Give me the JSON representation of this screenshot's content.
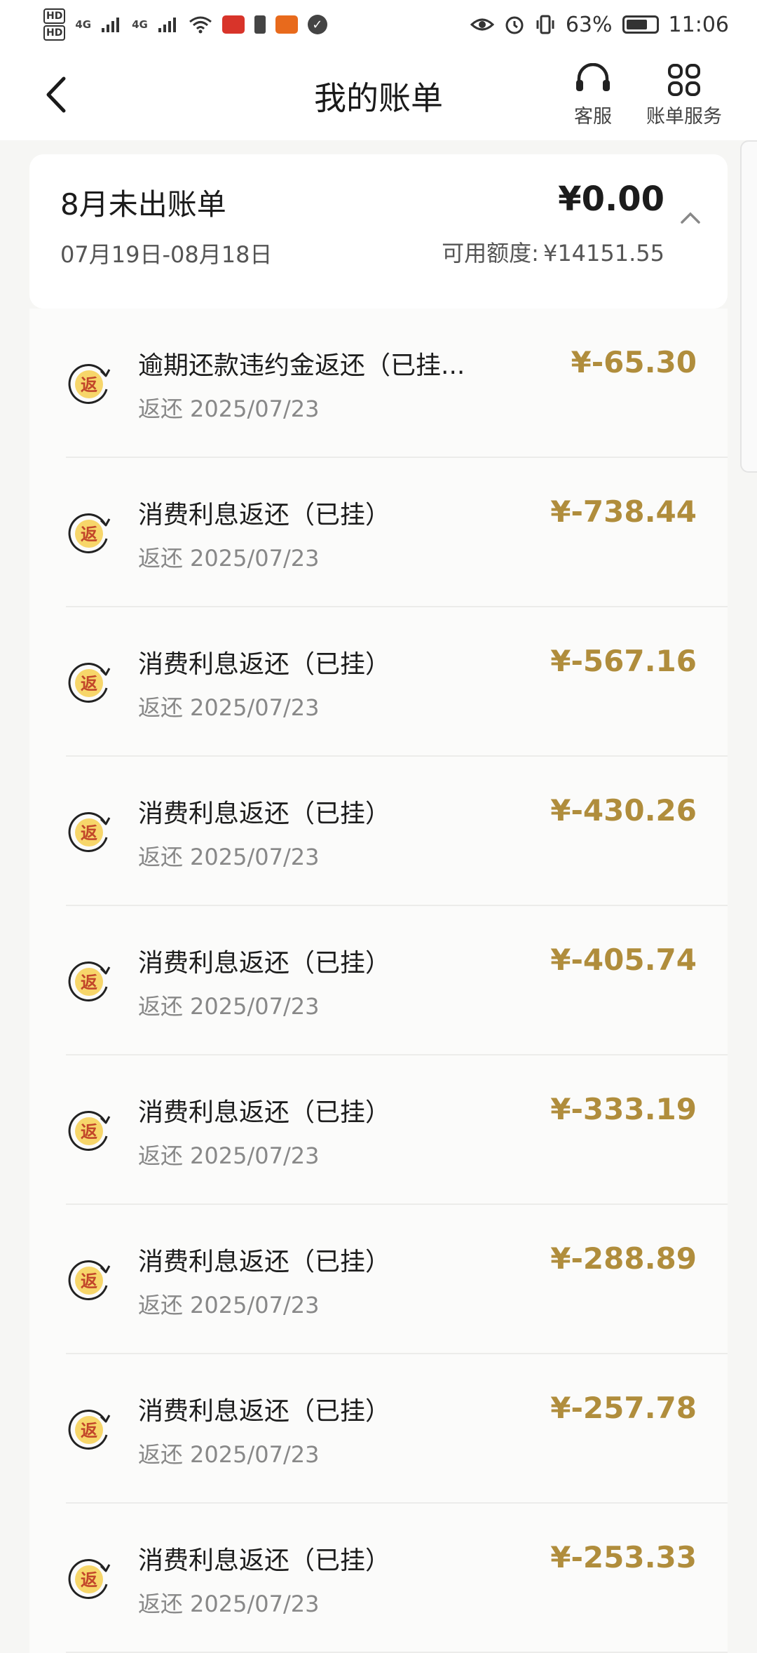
{
  "status_bar": {
    "battery_percent": "63%",
    "battery_level": 0.63,
    "time": "11:06",
    "network_1": "4G",
    "network_2": "4G",
    "hd_1": "HD",
    "hd_2": "HD"
  },
  "header": {
    "title": "我的账单",
    "actions": [
      {
        "label": "客服",
        "icon": "headset-icon"
      },
      {
        "label": "账单服务",
        "icon": "grid-icon"
      }
    ]
  },
  "summary": {
    "title": "8月未出账单",
    "period": "07月19日-08月18日",
    "amount": "¥0.00",
    "credit_label": "可用额度:",
    "credit_value": "¥14151.55"
  },
  "transactions": [
    {
      "title": "逾期还款违约金返还（已挂...",
      "type": "返还",
      "date": "2025/07/23",
      "amount": "¥-65.30"
    },
    {
      "title": "消费利息返还（已挂）",
      "type": "返还",
      "date": "2025/07/23",
      "amount": "¥-738.44"
    },
    {
      "title": "消费利息返还（已挂）",
      "type": "返还",
      "date": "2025/07/23",
      "amount": "¥-567.16"
    },
    {
      "title": "消费利息返还（已挂）",
      "type": "返还",
      "date": "2025/07/23",
      "amount": "¥-430.26"
    },
    {
      "title": "消费利息返还（已挂）",
      "type": "返还",
      "date": "2025/07/23",
      "amount": "¥-405.74"
    },
    {
      "title": "消费利息返还（已挂）",
      "type": "返还",
      "date": "2025/07/23",
      "amount": "¥-333.19"
    },
    {
      "title": "消费利息返还（已挂）",
      "type": "返还",
      "date": "2025/07/23",
      "amount": "¥-288.89"
    },
    {
      "title": "消费利息返还（已挂）",
      "type": "返还",
      "date": "2025/07/23",
      "amount": "¥-257.78"
    },
    {
      "title": "消费利息返还（已挂）",
      "type": "返还",
      "date": "2025/07/23",
      "amount": "¥-253.33"
    }
  ],
  "row_icon_glyph": "返",
  "colors": {
    "amount_gold": "#b08d3c",
    "icon_fill": "#f7d66a",
    "icon_text": "#c2462a"
  }
}
